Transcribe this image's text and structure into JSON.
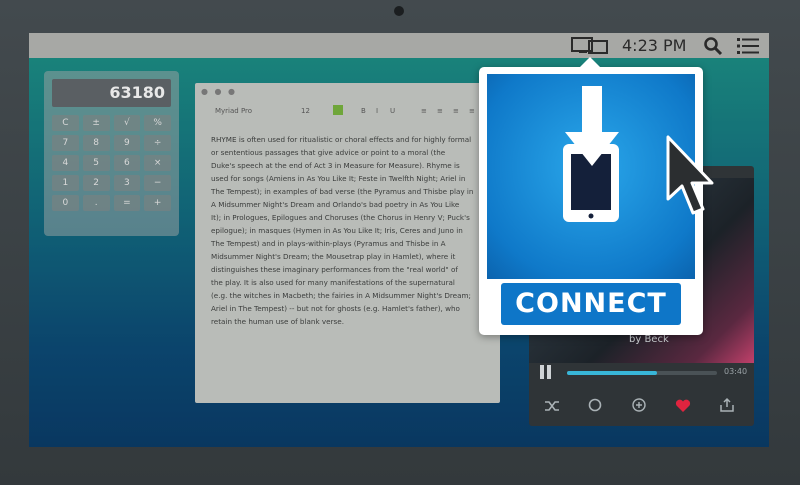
{
  "menubar": {
    "time": "4:23 PM",
    "icons": [
      "airplay-icon",
      "search-icon",
      "menu-icon"
    ]
  },
  "calculator": {
    "display": "63180",
    "keys": [
      "C",
      "±",
      "√",
      "%",
      "7",
      "8",
      "9",
      "÷",
      "4",
      "5",
      "6",
      "×",
      "1",
      "2",
      "3",
      "−",
      "0",
      ".",
      "=",
      "+"
    ]
  },
  "editor": {
    "font_name": "Myriad Pro",
    "font_size": "12",
    "format_buttons": [
      "B",
      "I",
      "U"
    ],
    "body_lines": [
      "RHYME is often used for ritualistic or choral effects and for highly formal",
      "or sententious passages that give advice or point to a moral (the",
      "Duke's speech at the end of Act 3 in Measure for Measure). Rhyme is",
      "used for songs (Amiens in As You Like It; Feste in Twelfth Night; Ariel in",
      "The Tempest); in examples of bad verse (the Pyramus and Thisbe play in",
      "A Midsummer Night's Dream and Orlando's bad poetry in As You Like",
      "It); in Prologues, Epilogues and Choruses (the Chorus in Henry V; Puck's",
      "epilogue); in masques (Hymen in As You Like It; Iris, Ceres and Juno in",
      "The Tempest) and in plays-within-plays (Pyramus and Thisbe in A",
      "Midsummer Night's Dream; the Mousetrap play in Hamlet), where it",
      "distinguishes these imaginary performances from the \"real world\" of",
      "the play. It is also used for many manifestations of the supernatural",
      "(e.g. the witches in Macbeth; the fairies in A Midsummer Night's Dream;",
      "Ariel in The Tempest) -- but not for ghosts (e.g. Hamlet's father), who",
      "retain the human use of blank verse."
    ]
  },
  "player": {
    "caption": "by Beck",
    "elapsed": "",
    "duration": "03:40",
    "progress_fraction": 0.6,
    "controls": [
      "shuffle-icon",
      "repeat-icon",
      "add-icon",
      "heart-icon",
      "share-icon"
    ],
    "heart_color": "#e0243f"
  },
  "popup": {
    "button_label": "CONNECT",
    "accent": "#0e76c8"
  }
}
